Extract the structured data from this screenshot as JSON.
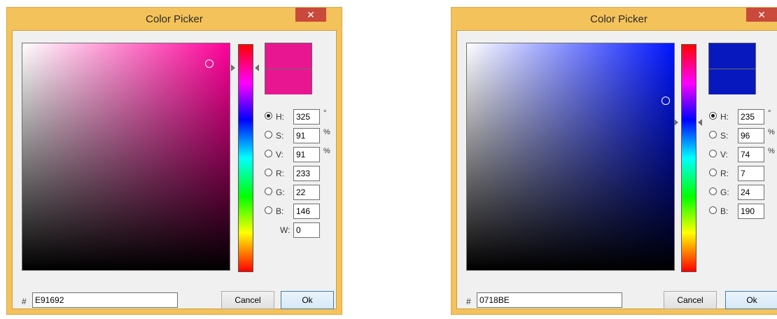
{
  "dialogs": [
    {
      "title": "Color Picker",
      "close_glyph": "✕",
      "hue_color": "#ff0099",
      "preview_color": "#E91692",
      "fields": [
        {
          "label": "H:",
          "value": "325",
          "unit": "°",
          "selected": true
        },
        {
          "label": "S:",
          "value": "91",
          "unit": "%",
          "selected": false
        },
        {
          "label": "V:",
          "value": "91",
          "unit": "%",
          "selected": false
        },
        {
          "label": "R:",
          "value": "233",
          "unit": "",
          "selected": false
        },
        {
          "label": "G:",
          "value": "22",
          "unit": "",
          "selected": false
        },
        {
          "label": "B:",
          "value": "146",
          "unit": "",
          "selected": false
        }
      ],
      "w_field": {
        "label": "W:",
        "value": "0"
      },
      "hash": "#",
      "hex": "E91692",
      "cancel_label": "Cancel",
      "ok_label": "Ok"
    },
    {
      "title": "Color Picker",
      "close_glyph": "✕",
      "hue_color": "#0015ff",
      "preview_color": "#0718BE",
      "fields": [
        {
          "label": "H:",
          "value": "235",
          "unit": "°",
          "selected": true
        },
        {
          "label": "S:",
          "value": "96",
          "unit": "%",
          "selected": false
        },
        {
          "label": "V:",
          "value": "74",
          "unit": "%",
          "selected": false
        },
        {
          "label": "R:",
          "value": "7",
          "unit": "",
          "selected": false
        },
        {
          "label": "G:",
          "value": "24",
          "unit": "",
          "selected": false
        },
        {
          "label": "B:",
          "value": "190",
          "unit": "",
          "selected": false
        }
      ],
      "hash": "#",
      "hex": "0718BE",
      "cancel_label": "Cancel",
      "ok_label": "Ok"
    }
  ]
}
